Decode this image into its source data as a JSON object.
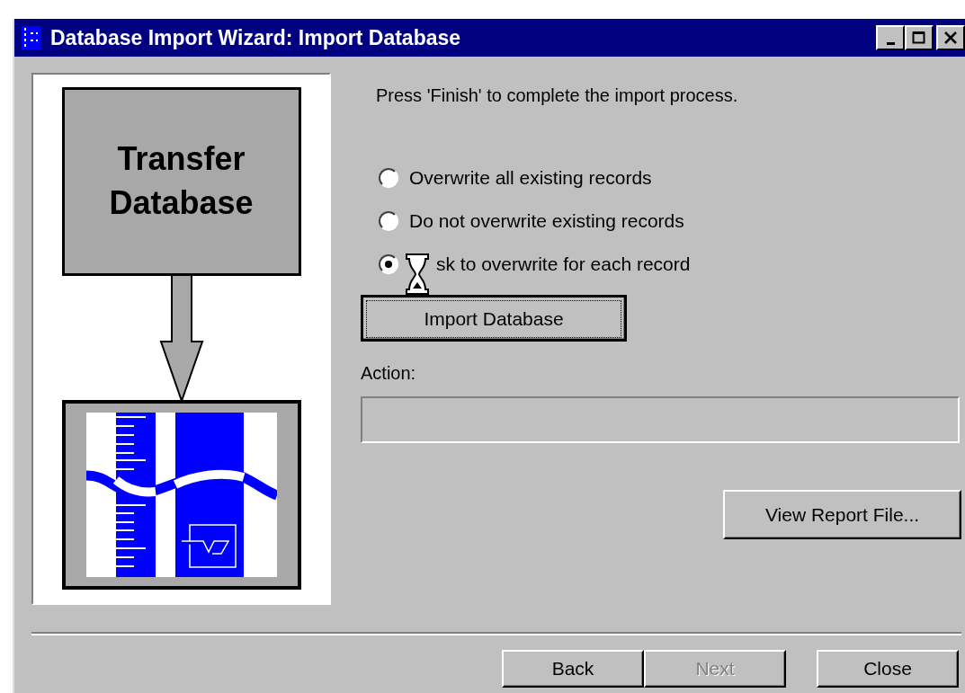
{
  "window": {
    "title": "Database Import Wizard: Import Database"
  },
  "panel": {
    "heading": "Transfer Database"
  },
  "instruction": "Press 'Finish' to complete the import process.",
  "options": [
    {
      "label": "Overwrite all existing records",
      "selected": false
    },
    {
      "label": "Do not overwrite existing records",
      "selected": false
    },
    {
      "label": "sk to overwrite for each record",
      "selected": true,
      "busy_cursor": true
    }
  ],
  "import_button": "Import Database",
  "action": {
    "label": "Action:"
  },
  "view_report_button": "View Report File...",
  "buttons": [
    {
      "label": "Back",
      "disabled": false
    },
    {
      "label": "Next",
      "disabled": true
    },
    {
      "label": "Close",
      "disabled": false
    }
  ]
}
